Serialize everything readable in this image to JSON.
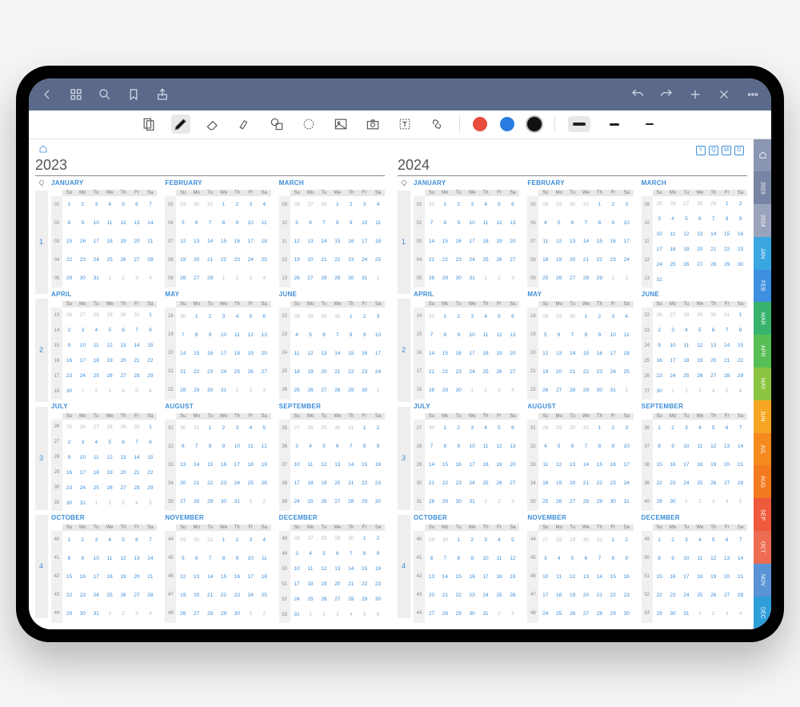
{
  "day_labels": [
    "Su",
    "Mo",
    "Tu",
    "We",
    "Th",
    "Fr",
    "Sa"
  ],
  "q_header": "Q",
  "nav_boxes": [
    "Y",
    "Q",
    "M",
    "D"
  ],
  "colors": {
    "red": "#e74c3c",
    "blue": "#2b7de1",
    "black": "#111"
  },
  "tabs": [
    {
      "label": "home",
      "bg": "#8b96b3",
      "type": "icon"
    },
    {
      "label": "2023",
      "bg": "#7884a3"
    },
    {
      "label": "2024",
      "bg": "#9aa3bc"
    },
    {
      "label": "JAN",
      "bg": "#3aa7e0"
    },
    {
      "label": "FEB",
      "bg": "#3d8fe0"
    },
    {
      "label": "MAR",
      "bg": "#37b36e"
    },
    {
      "label": "APR",
      "bg": "#57bf55"
    },
    {
      "label": "MAY",
      "bg": "#8bc540"
    },
    {
      "label": "JUN",
      "bg": "#f6a623"
    },
    {
      "label": "JUL",
      "bg": "#f58a1f"
    },
    {
      "label": "AUG",
      "bg": "#f47a20"
    },
    {
      "label": "SEP",
      "bg": "#ef5a3c"
    },
    {
      "label": "OCT",
      "bg": "#ee6c52"
    },
    {
      "label": "NOV",
      "bg": "#5a94d6"
    },
    {
      "label": "DEC",
      "bg": "#2e9ed9"
    }
  ],
  "years": [
    {
      "title": "2023",
      "quarters": [
        "1",
        "2",
        "3",
        "4"
      ],
      "months": [
        {
          "name": "JANUARY",
          "weeks": [
            "01",
            "02",
            "03",
            "04",
            "05"
          ],
          "lead": 0,
          "days": 31,
          "prev": 0
        },
        {
          "name": "FEBRUARY",
          "weeks": [
            "05",
            "06",
            "07",
            "08",
            "09"
          ],
          "lead": 3,
          "days": 28,
          "prev": 31
        },
        {
          "name": "MARCH",
          "weeks": [
            "09",
            "10",
            "11",
            "12",
            "13"
          ],
          "lead": 3,
          "days": 31,
          "prev": 28
        },
        {
          "name": "APRIL",
          "weeks": [
            "13",
            "14",
            "15",
            "16",
            "17",
            "18"
          ],
          "lead": 6,
          "days": 30,
          "prev": 31
        },
        {
          "name": "MAY",
          "weeks": [
            "18",
            "19",
            "20",
            "21",
            "22"
          ],
          "lead": 1,
          "days": 31,
          "prev": 30
        },
        {
          "name": "JUNE",
          "weeks": [
            "22",
            "23",
            "24",
            "25",
            "26"
          ],
          "lead": 4,
          "days": 30,
          "prev": 31
        },
        {
          "name": "JULY",
          "weeks": [
            "26",
            "27",
            "28",
            "29",
            "30",
            "31"
          ],
          "lead": 6,
          "days": 31,
          "prev": 30
        },
        {
          "name": "AUGUST",
          "weeks": [
            "31",
            "32",
            "33",
            "34",
            "35"
          ],
          "lead": 2,
          "days": 31,
          "prev": 31
        },
        {
          "name": "SEPTEMBER",
          "weeks": [
            "35",
            "36",
            "37",
            "38",
            "39"
          ],
          "lead": 5,
          "days": 30,
          "prev": 31
        },
        {
          "name": "OCTOBER",
          "weeks": [
            "40",
            "41",
            "42",
            "43",
            "44"
          ],
          "lead": 0,
          "days": 31,
          "prev": 30
        },
        {
          "name": "NOVEMBER",
          "weeks": [
            "44",
            "45",
            "46",
            "47",
            "48"
          ],
          "lead": 3,
          "days": 30,
          "prev": 31
        },
        {
          "name": "DECEMBER",
          "weeks": [
            "48",
            "49",
            "50",
            "51",
            "52",
            "53"
          ],
          "lead": 5,
          "days": 31,
          "prev": 30
        }
      ]
    },
    {
      "title": "2024",
      "quarters": [
        "1",
        "2",
        "3",
        "4"
      ],
      "months": [
        {
          "name": "JANUARY",
          "weeks": [
            "01",
            "02",
            "03",
            "04",
            "05"
          ],
          "lead": 1,
          "days": 31,
          "prev": 31
        },
        {
          "name": "FEBRUARY",
          "weeks": [
            "05",
            "06",
            "07",
            "08",
            "09"
          ],
          "lead": 4,
          "days": 29,
          "prev": 31
        },
        {
          "name": "MARCH",
          "weeks": [
            "09",
            "10",
            "11",
            "12",
            "13"
          ],
          "lead": 5,
          "days": 31,
          "prev": 29
        },
        {
          "name": "APRIL",
          "weeks": [
            "14",
            "15",
            "16",
            "17",
            "18"
          ],
          "lead": 1,
          "days": 30,
          "prev": 31
        },
        {
          "name": "MAY",
          "weeks": [
            "18",
            "19",
            "20",
            "21",
            "22"
          ],
          "lead": 3,
          "days": 31,
          "prev": 30
        },
        {
          "name": "JUNE",
          "weeks": [
            "22",
            "23",
            "24",
            "25",
            "26",
            "27"
          ],
          "lead": 6,
          "days": 30,
          "prev": 31
        },
        {
          "name": "JULY",
          "weeks": [
            "27",
            "28",
            "29",
            "30",
            "31"
          ],
          "lead": 1,
          "days": 31,
          "prev": 30
        },
        {
          "name": "AUGUST",
          "weeks": [
            "31",
            "32",
            "33",
            "34",
            "35"
          ],
          "lead": 4,
          "days": 31,
          "prev": 31
        },
        {
          "name": "SEPTEMBER",
          "weeks": [
            "36",
            "37",
            "38",
            "39",
            "40"
          ],
          "lead": 0,
          "days": 30,
          "prev": 31
        },
        {
          "name": "OCTOBER",
          "weeks": [
            "40",
            "41",
            "42",
            "43",
            "44"
          ],
          "lead": 2,
          "days": 31,
          "prev": 30
        },
        {
          "name": "NOVEMBER",
          "weeks": [
            "44",
            "45",
            "46",
            "47",
            "48"
          ],
          "lead": 5,
          "days": 30,
          "prev": 31
        },
        {
          "name": "DECEMBER",
          "weeks": [
            "49",
            "50",
            "51",
            "52",
            "53"
          ],
          "lead": 0,
          "days": 31,
          "prev": 30
        }
      ]
    }
  ]
}
